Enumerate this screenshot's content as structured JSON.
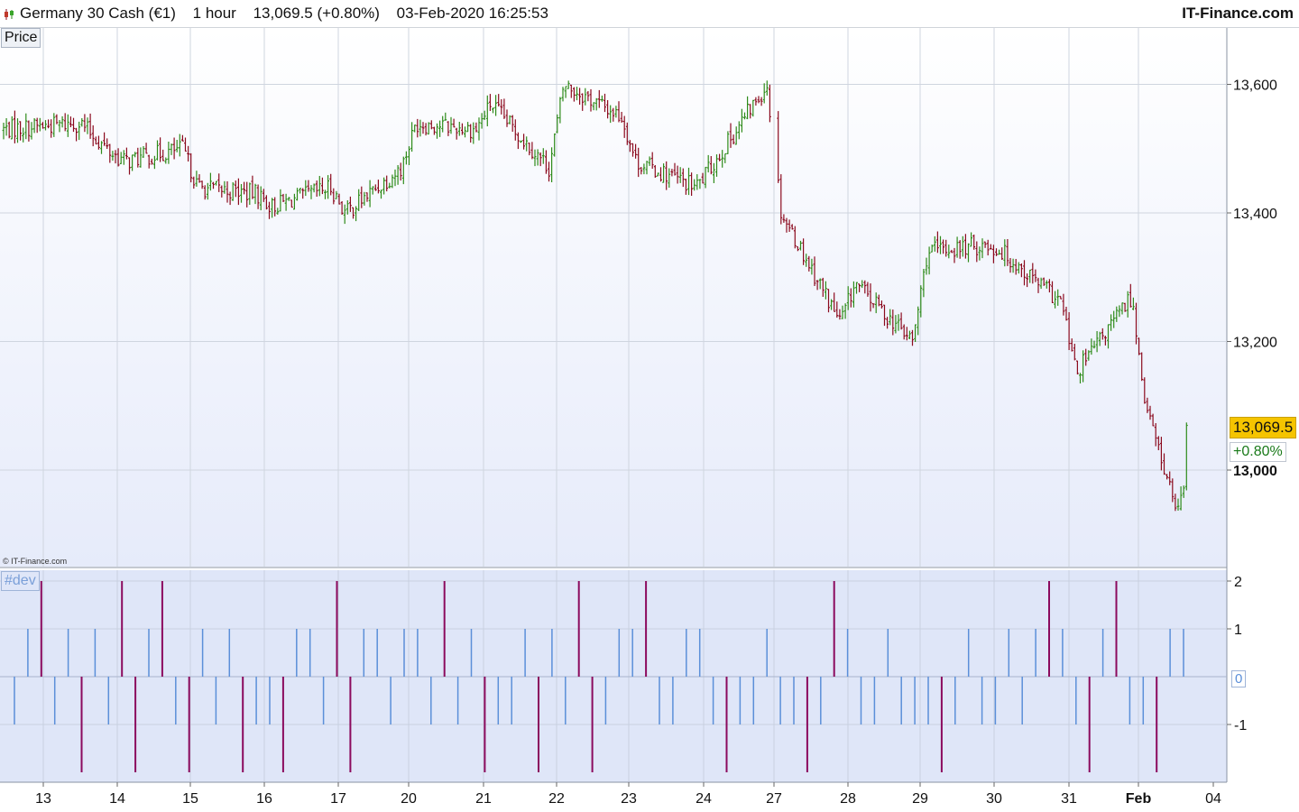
{
  "header": {
    "instrument": "Germany 30 Cash (€1)",
    "timeframe": "1 hour",
    "last_quote": "13,069.5 (+0.80%)",
    "datetime": "03-Feb-2020 16:25:53",
    "brand": "IT-Finance.com"
  },
  "price_panel": {
    "label": "Price",
    "copyright": "© IT-Finance.com",
    "last_price_tag": "13,069.5",
    "change_tag": "+0.80%",
    "colors": {
      "up": "#2e8b1a",
      "down": "#8b0a1e",
      "price_tag_bg": "#f5c400",
      "change_text": "#1a7a1a"
    }
  },
  "indicator_panel": {
    "label": "#dev",
    "zero_tag": "0",
    "colors": {
      "small": "#5b8fd9",
      "large": "#8b0a5e"
    }
  },
  "chart_data": [
    {
      "type": "candlestick",
      "title": "Germany 30 Cash (€1)",
      "interval": "1 hour",
      "y_ticks": [
        13000,
        13200,
        13400,
        13600
      ],
      "y_tick_labels": [
        "13,000",
        "13,200",
        "13,400",
        "13,600"
      ],
      "ylim": [
        12870,
        13700
      ],
      "x_tick_labels": [
        "13",
        "14",
        "15",
        "16",
        "17",
        "20",
        "21",
        "22",
        "23",
        "24",
        "27",
        "28",
        "29",
        "30",
        "31",
        "Feb",
        "04"
      ],
      "grid": true,
      "last_price": 13069.5,
      "change_percent": "+0.80%",
      "close_path": [
        [
          "13",
          13530
        ],
        [
          "13",
          13540
        ],
        [
          "13",
          13495
        ],
        [
          "14",
          13480
        ],
        [
          "14",
          13500
        ],
        [
          "15",
          13440
        ],
        [
          "15",
          13430
        ],
        [
          "16",
          13410
        ],
        [
          "16",
          13440
        ],
        [
          "17",
          13400
        ],
        [
          "17",
          13470
        ],
        [
          "20",
          13540
        ],
        [
          "20",
          13530
        ],
        [
          "21",
          13570
        ],
        [
          "21",
          13470
        ],
        [
          "22",
          13600
        ],
        [
          "22",
          13550
        ],
        [
          "23",
          13480
        ],
        [
          "23",
          13440
        ],
        [
          "24",
          13470
        ],
        [
          "24",
          13600
        ],
        [
          "27",
          13400
        ],
        [
          "27",
          13230
        ],
        [
          "28",
          13290
        ],
        [
          "28",
          13200
        ],
        [
          "29",
          13340
        ],
        [
          "29",
          13350
        ],
        [
          "30",
          13340
        ],
        [
          "30",
          13260
        ],
        [
          "31",
          13150
        ],
        [
          "31",
          13270
        ],
        [
          "Feb",
          13100
        ],
        [
          "Feb",
          12940
        ],
        [
          "Feb",
          13010
        ],
        [
          "04",
          13069.5
        ]
      ],
      "notable_points": {
        "high": 13640,
        "low": 12890
      }
    },
    {
      "type": "bar",
      "title": "#dev",
      "y_ticks": [
        -1,
        0,
        1,
        2
      ],
      "y_tick_labels": [
        "-1",
        "0",
        "1",
        "2"
      ],
      "ylim": [
        -1.2,
        2.2
      ],
      "series": [
        {
          "name": "#dev",
          "values": [
            -1,
            1,
            2,
            -1,
            1,
            -2,
            1,
            -1,
            2,
            -2,
            1,
            2,
            -1,
            -2,
            1,
            -1,
            1,
            -2,
            -1,
            -1,
            -2,
            1,
            1,
            -1,
            2,
            -2,
            1,
            1,
            -1,
            1,
            1,
            -1,
            2,
            -1,
            1,
            -2,
            -1,
            -1,
            1,
            -2,
            1,
            -1,
            2,
            -2,
            -1,
            1,
            1,
            2,
            -1,
            -1,
            1,
            1,
            -1,
            -2,
            -1,
            -1,
            1,
            -1,
            -1,
            -2,
            -1,
            2,
            1,
            -1,
            -1,
            1,
            -1,
            -1,
            -1,
            -2,
            -1,
            1,
            -1,
            -1,
            1,
            -1,
            1,
            2,
            1,
            -1,
            -2,
            1,
            2,
            -1,
            -1,
            -2,
            1,
            1
          ]
        }
      ]
    }
  ]
}
